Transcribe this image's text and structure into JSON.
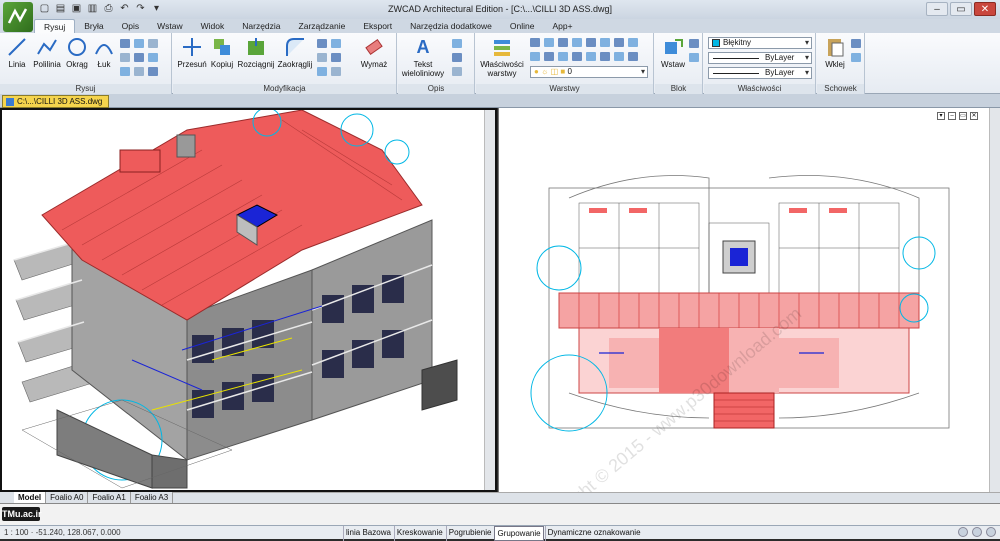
{
  "window": {
    "title": "ZWCAD Architectural Edition - [C:\\...\\CILLI 3D ASS.dwg]"
  },
  "qat_icons": [
    "new-icon",
    "open-icon",
    "save-icon",
    "saveas-icon",
    "print-icon",
    "undo-icon",
    "redo-icon",
    "properties-icon"
  ],
  "tabs": [
    "Rysuj",
    "Bryła",
    "Opis",
    "Wstaw",
    "Widok",
    "Narzędzia",
    "Zarządzanie",
    "Eksport",
    "Narzędzia dodatkowe",
    "Online",
    "App+"
  ],
  "active_tab": "Rysuj",
  "ribbon": {
    "rysuj": {
      "label": "Rysuj",
      "buttons": [
        "Linia",
        "Polilinia",
        "Okrąg",
        "Łuk"
      ]
    },
    "modyfikacja": {
      "label": "Modyfikacja",
      "buttons": [
        "Przesuń",
        "Kopiuj",
        "Rozciągnij",
        "Zaokrąglij",
        "Wymaż"
      ]
    },
    "opis": {
      "label": "Opis",
      "button": "Tekst wieloliniowy"
    },
    "warstwy": {
      "label": "Warstwy",
      "button": "Właściwości warstwy",
      "layer_value": "0"
    },
    "blok": {
      "label": "Blok",
      "button": "Wstaw"
    },
    "wlasciwosci": {
      "label": "Właściwości",
      "color": "Błękitny",
      "linetype": "ByLayer",
      "lineweight": "ByLayer"
    },
    "schowek": {
      "label": "Schowek",
      "button": "Wklej"
    }
  },
  "doc_tab": "C:\\...\\CILLI 3D ASS.dwg",
  "layout_tabs": [
    "Model",
    "Foalio A0",
    "Foalio A1",
    "Foalio A3"
  ],
  "active_layout": "Model",
  "command_line": "",
  "watermark_logo": "TMu.ac.ir",
  "watermark_text": "Copyright © 2015 - www.p30download.com",
  "status": {
    "coords": "1 : 100 ·  -51.240, 128.067, 0.000",
    "toggles": [
      "linia Bazowa",
      "Kreskowanie",
      "Pogrubienie",
      "Grupowanie",
      "Dynamiczne oznakowanie"
    ],
    "active_toggle": "Grupowanie"
  },
  "colors": {
    "roof": "#ee5b5b",
    "cyan": "#00b7e5",
    "blue": "#1a24d6",
    "plan_red": "#f26666",
    "accent": "#f5d44d"
  }
}
